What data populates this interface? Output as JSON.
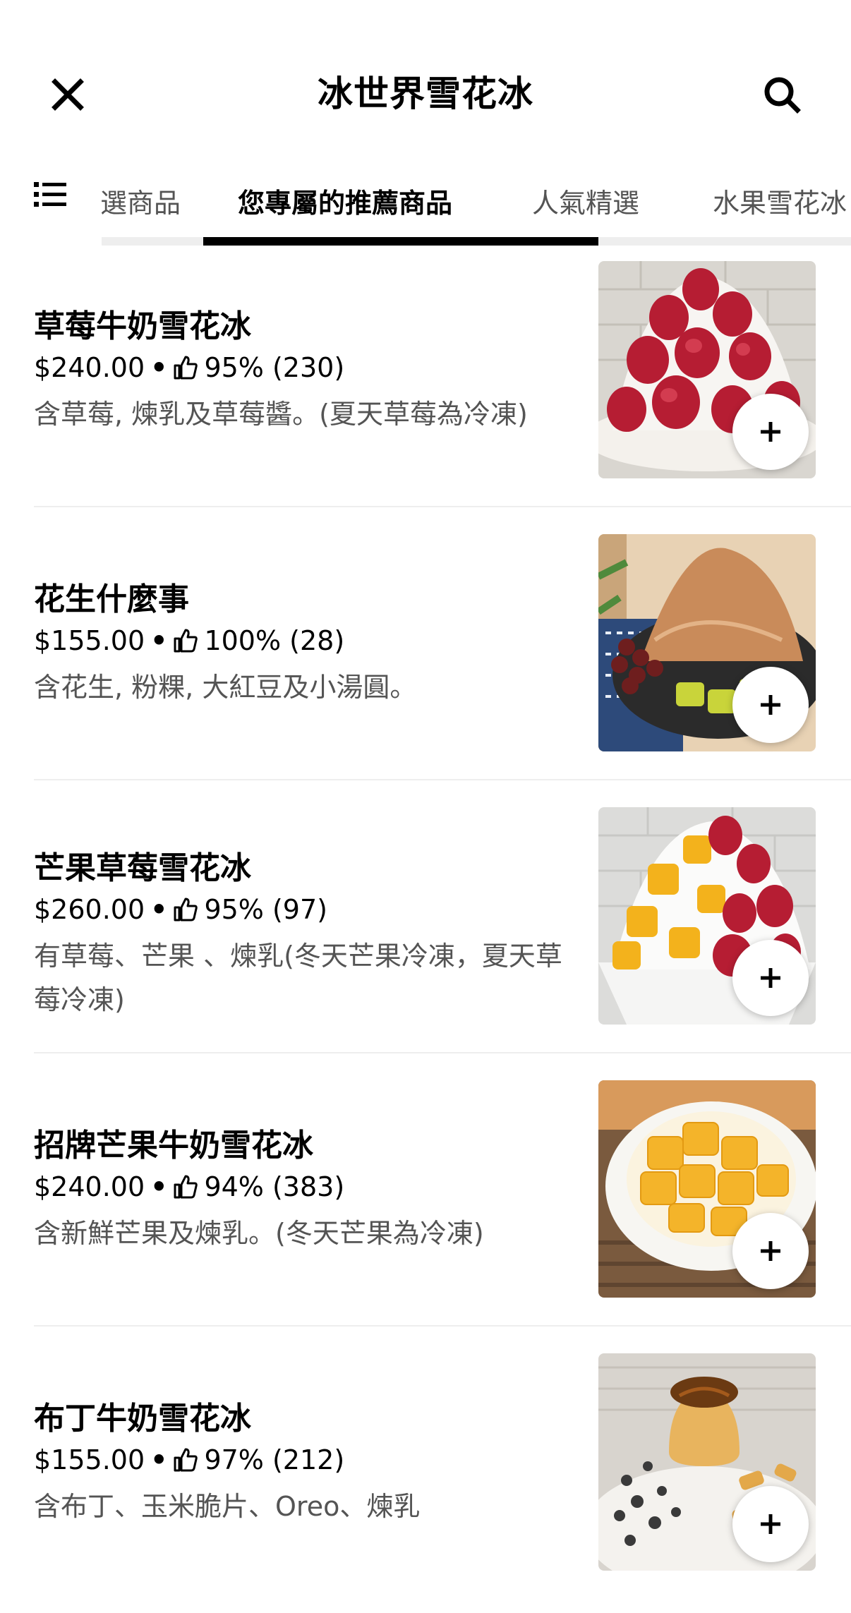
{
  "header": {
    "title": "冰世界雪花冰",
    "close_icon": "close-icon",
    "search_icon": "search-icon"
  },
  "tabs": {
    "menu_icon": "list-icon",
    "items": [
      {
        "label": "選商品",
        "active": false
      },
      {
        "label": "您專屬的推薦商品",
        "active": true
      },
      {
        "label": "人氣精選",
        "active": false
      },
      {
        "label": "水果雪花冰",
        "active": false
      }
    ]
  },
  "colors": {
    "text_primary": "#000000",
    "text_secondary": "#545454",
    "divider": "#eeeeee",
    "indicator": "#000000"
  },
  "items": [
    {
      "name": "草莓牛奶雪花冰",
      "price": "$240.00",
      "rating": "95% (230)",
      "description": "含草莓, 煉乳及草莓醬。(夏天草莓為冷凍)",
      "image": "strawberry-milk-shaved-ice"
    },
    {
      "name": "花生什麼事",
      "price": "$155.00",
      "rating": "100% (28)",
      "description": "含花生, 粉粿, 大紅豆及小湯圓。",
      "image": "peanut-shaved-ice"
    },
    {
      "name": "芒果草莓雪花冰",
      "price": "$260.00",
      "rating": "95% (97)",
      "description": "有草莓、芒果 、煉乳(冬天芒果冷凍，夏天草莓冷凍)",
      "image": "mango-strawberry-shaved-ice"
    },
    {
      "name": "招牌芒果牛奶雪花冰",
      "price": "$240.00",
      "rating": "94% (383)",
      "description": "含新鮮芒果及煉乳。(冬天芒果為冷凍)",
      "image": "mango-milk-shaved-ice"
    },
    {
      "name": "布丁牛奶雪花冰",
      "price": "$155.00",
      "rating": "97% (212)",
      "description": "含布丁、玉米脆片、Oreo、煉乳",
      "image": "pudding-milk-shaved-ice"
    }
  ]
}
